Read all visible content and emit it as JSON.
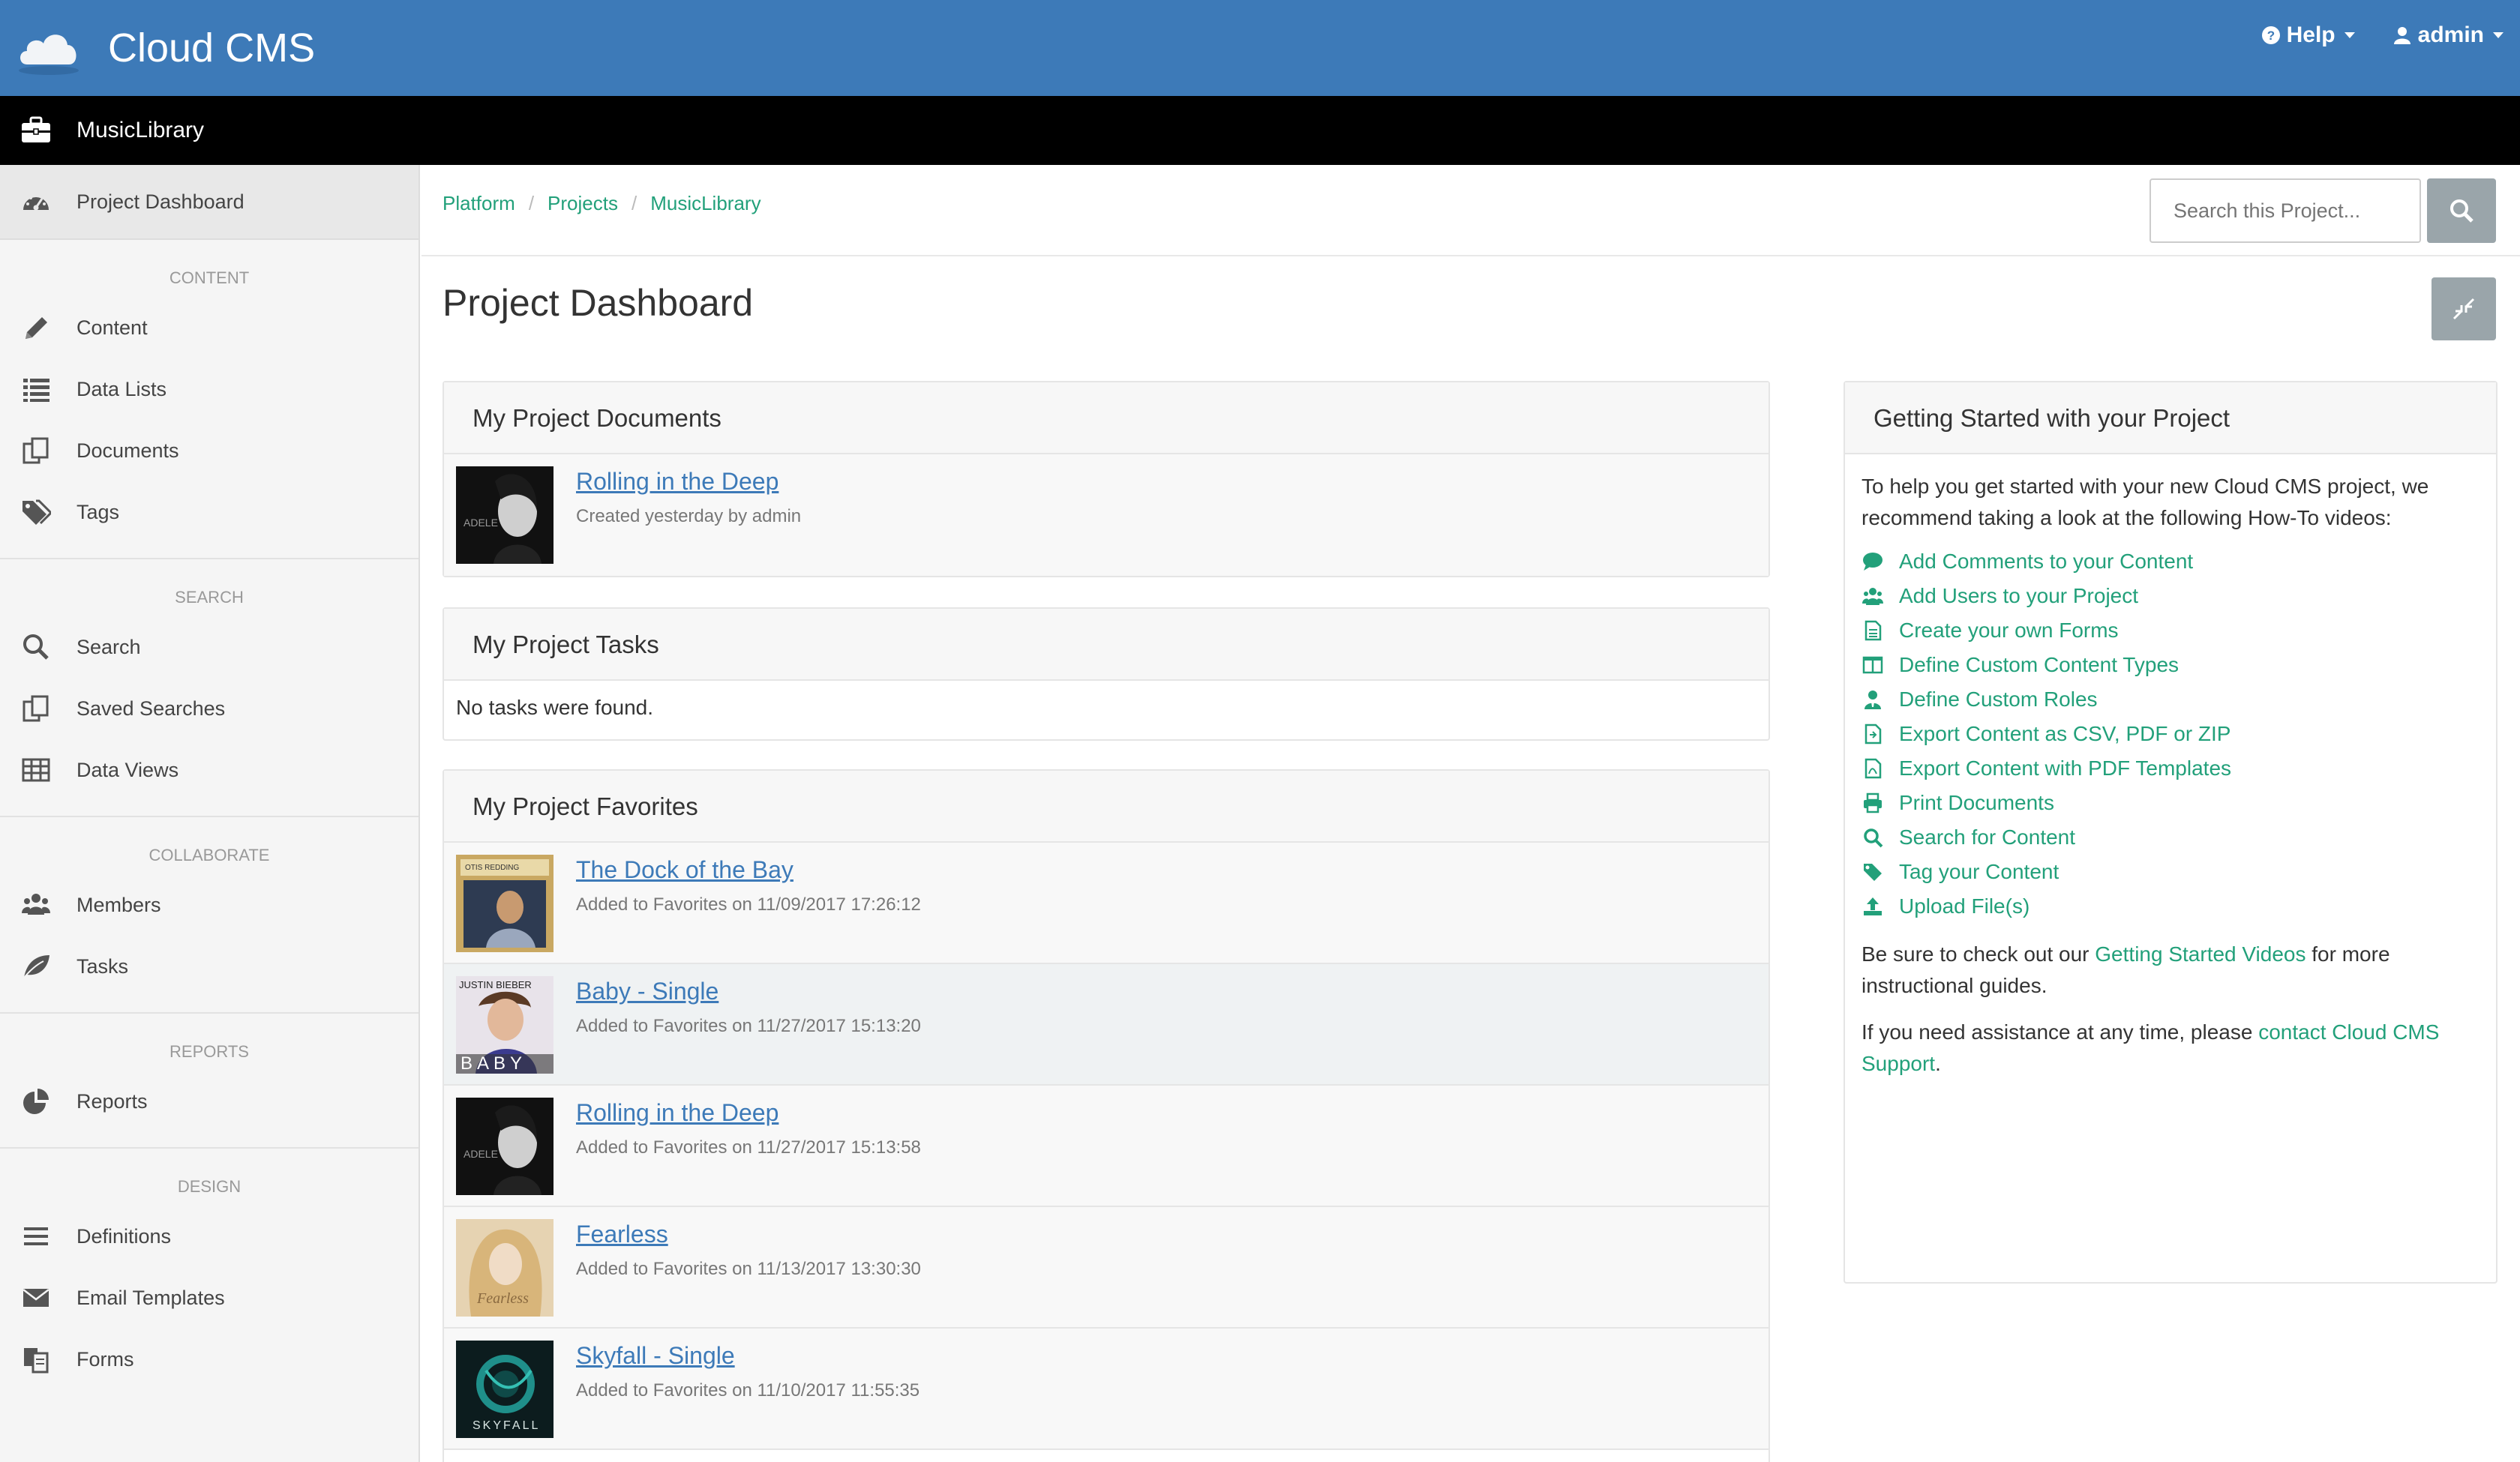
{
  "app": {
    "name": "Cloud CMS"
  },
  "topnav": {
    "help": "Help",
    "user": "admin"
  },
  "project": {
    "name": "MusicLibrary"
  },
  "sidebar": {
    "dashboard": "Project Dashboard",
    "sections": {
      "content": "CONTENT",
      "search": "SEARCH",
      "collaborate": "COLLABORATE",
      "reports": "REPORTS",
      "design": "DESIGN"
    },
    "content_items": [
      "Content",
      "Data Lists",
      "Documents",
      "Tags"
    ],
    "search_items": [
      "Search",
      "Saved Searches",
      "Data Views"
    ],
    "collaborate_items": [
      "Members",
      "Tasks"
    ],
    "reports_items": [
      "Reports"
    ],
    "design_items": [
      "Definitions",
      "Email Templates",
      "Forms"
    ]
  },
  "breadcrumb": [
    "Platform",
    "Projects",
    "MusicLibrary"
  ],
  "search": {
    "placeholder": "Search this Project..."
  },
  "page": {
    "title": "Project Dashboard"
  },
  "documents": {
    "title": "My Project Documents",
    "items": [
      {
        "title": "Rolling in the Deep",
        "sub": "Created yesterday by admin"
      }
    ]
  },
  "tasks": {
    "title": "My Project Tasks",
    "empty": "No tasks were found."
  },
  "favorites": {
    "title": "My Project Favorites",
    "items": [
      {
        "title": "The Dock of the Bay",
        "sub": "Added to Favorites on 11/09/2017 17:26:12"
      },
      {
        "title": "Baby - Single",
        "sub": "Added to Favorites on 11/27/2017 15:13:20"
      },
      {
        "title": "Rolling in the Deep",
        "sub": "Added to Favorites on 11/27/2017 15:13:58"
      },
      {
        "title": "Fearless",
        "sub": "Added to Favorites on 11/13/2017 13:30:30"
      },
      {
        "title": "Skyfall - Single",
        "sub": "Added to Favorites on 11/10/2017 11:55:35"
      }
    ]
  },
  "getting_started": {
    "title": "Getting Started with your Project",
    "intro": "To help you get started with your new Cloud CMS project, we recommend taking a look at the following How-To videos:",
    "links": [
      "Add Comments to your Content",
      "Add Users to your Project",
      "Create your own Forms",
      "Define Custom Content Types",
      "Define Custom Roles",
      "Export Content as CSV, PDF or ZIP",
      "Export Content with PDF Templates",
      "Print Documents",
      "Search for Content",
      "Tag your Content",
      "Upload File(s)"
    ],
    "check_pre": "Be sure to check out our ",
    "check_link": "Getting Started Videos",
    "check_post": " for more instructional guides.",
    "assist_pre": "If you need assistance at any time, please ",
    "assist_link": "contact Cloud CMS Support",
    "assist_post": "."
  },
  "colors": {
    "header_blue": "#3d7ab8",
    "link_green": "#22a07a",
    "link_blue": "#3d7ab8"
  }
}
